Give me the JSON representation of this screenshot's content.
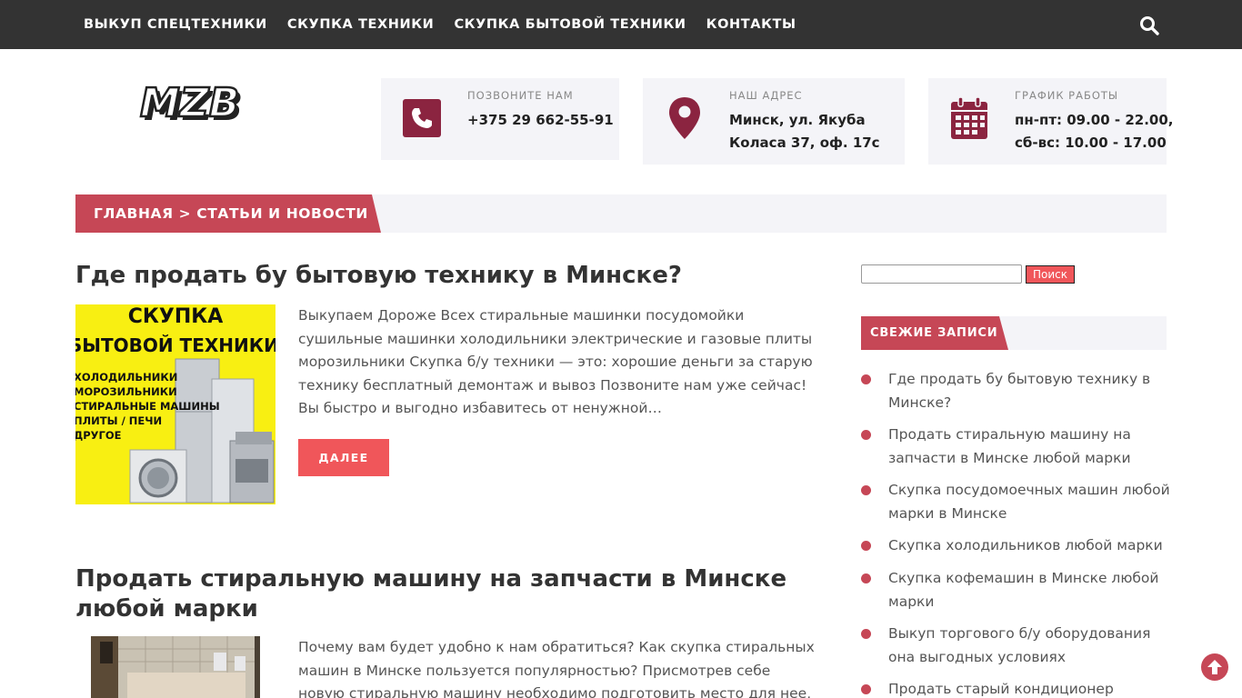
{
  "nav": {
    "items": [
      "ВЫКУП СПЕЦТЕХНИКИ",
      "СКУПКА ТЕХНИКИ",
      "СКУПКА БЫТОВОЙ ТЕХНИКИ",
      "КОНТАКТЫ"
    ],
    "search_icon": "search-icon"
  },
  "logo": {
    "text": "MZB"
  },
  "contacts": {
    "phone": {
      "label": "ПОЗВОНИТЕ НАМ",
      "value": "+375 29 662-55-91",
      "icon": "phone-icon"
    },
    "address": {
      "label": "НАШ АДРЕС",
      "line1": "Минск, ул. Якуба",
      "line2": "Коласа 37, оф. 17с",
      "icon": "map-pin-icon"
    },
    "hours": {
      "label": "ГРАФИК РАБОТЫ",
      "line1": "пн-пт: 09.00 - 22.00,",
      "line2": "сб-вс: 10.00 - 17.00",
      "icon": "calendar-icon"
    }
  },
  "breadcrumb": {
    "text": "ГЛАВНАЯ > СТАТЬИ И НОВОСТИ"
  },
  "posts": [
    {
      "title": "Где продать бу бытовую технику в Минске?",
      "thumb": {
        "line1": "СКУПКА",
        "line2": "БЫТОВОЙ ТЕХНИКИ",
        "list": [
          "ХОЛОДИЛЬНИКИ",
          "МОРОЗИЛЬНИКИ",
          "СТИРАЛЬНЫЕ МАШИНЫ",
          "ПЛИТЫ / ПЕЧИ",
          "ДРУГОЕ"
        ]
      },
      "excerpt": "Выкупаем Дороже Всех стиральные машинки посудомойки сушильные машинки холодильники электрические и газовые плиты морозильники Скупка б/у техники — это: хорошие деньги за старую технику бесплатный демонтаж и вывоз Позвоните нам уже сейчас! Вы быстро и выгодно избавитесь от ненужной…",
      "more_label": "ДАЛЕЕ"
    },
    {
      "title": "Продать стиральную машину на запчасти в Минске любой марки",
      "excerpt": "Почему вам будет удобно к нам обратиться? Как скупка стиральных машин в Минске пользуется популярностью? Присмотрев себе новую стиральную машину необходимо подготовить место для нее, а для"
    }
  ],
  "sidebar": {
    "search_button": "Поиск",
    "widget_title": "СВЕЖИЕ ЗАПИСИ",
    "recent": [
      "Где продать бу бытовую технику в Минске?",
      "Продать стиральную машину на запчасти в Минске любой марки",
      "Скупка посудомоечных машин любой марки в Минске",
      "Скупка холодильников любой марки",
      "Скупка кофемашин в Минске любой марки",
      "Выкуп торгового б/у оборудования она выгодных условиях",
      "Продать старый кондиционер"
    ]
  },
  "colors": {
    "accent": "#c64756",
    "button": "#f0565a",
    "nav_bg": "#333333",
    "icon": "#8b2440"
  },
  "scroll_top_icon": "arrow-up-icon"
}
